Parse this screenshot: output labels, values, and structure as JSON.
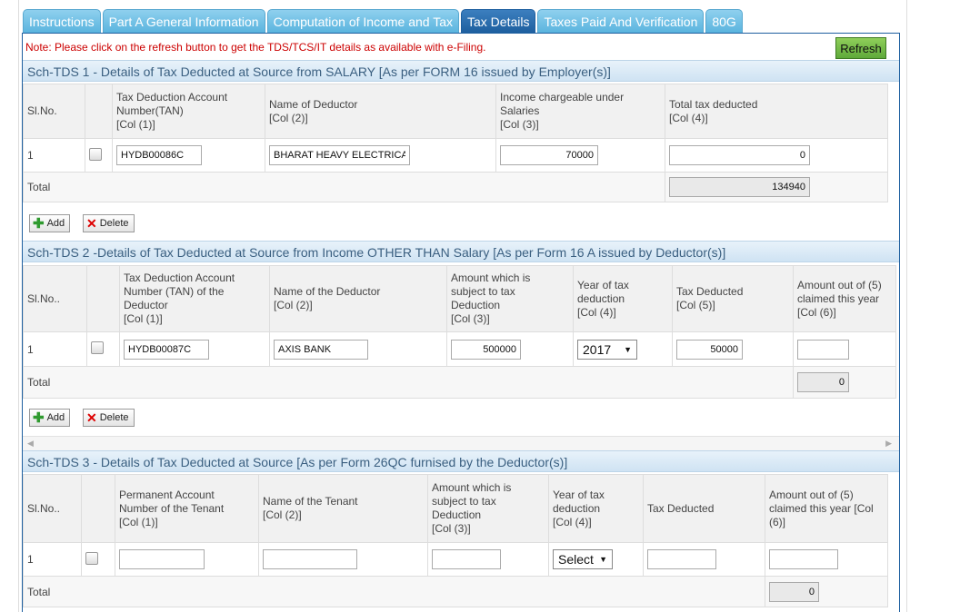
{
  "tabs": [
    "Instructions",
    "Part A General Information",
    "Computation of Income and Tax",
    "Tax Details",
    "Taxes Paid And Verification",
    "80G"
  ],
  "active_tab": "Tax Details",
  "note": "Note: Please click on the refresh button to get the TDS/TCS/IT details as available with e-Filing.",
  "refresh_label": "Refresh",
  "add_label": "Add",
  "delete_label": "Delete",
  "tds1": {
    "title": "Sch-TDS 1 - Details of Tax Deducted at Source from SALARY [As per FORM 16 issued by Employer(s)]",
    "headers": {
      "slno": "Sl.No.",
      "tan_l1": "Tax Deduction Account",
      "tan_l2": "Number(TAN)",
      "tan_l3": "[Col (1)]",
      "name_l1": "Name of Deductor",
      "name_l2": "[Col (2)]",
      "income_l1": "Income chargeable under",
      "income_l2": "Salaries",
      "income_l3": "[Col (3)]",
      "tax_l1": "Total tax deducted",
      "tax_l2": "[Col (4)]"
    },
    "row": {
      "sl": "1",
      "tan": "HYDB00086C",
      "name": "BHARAT HEAVY ELECTRICAL",
      "income": "70000",
      "tax": "0"
    },
    "total_label": "Total",
    "total_value": "134940"
  },
  "tds2": {
    "title": "Sch-TDS 2 -Details of Tax Deducted at Source from Income OTHER THAN Salary [As per Form 16 A issued by Deductor(s)]",
    "headers": {
      "slno": "Sl.No..",
      "tan_l1": "Tax Deduction Account",
      "tan_l2": "Number (TAN) of the",
      "tan_l3": "Deductor",
      "tan_l4": "[Col (1)]",
      "name_l1": "Name of the Deductor",
      "name_l2": "[Col (2)]",
      "amt_l1": "Amount which is",
      "amt_l2": "subject to tax",
      "amt_l3": "Deduction",
      "amt_l4": "[Col (3)]",
      "year_l1": "Year of tax",
      "year_l2": "deduction",
      "year_l3": "[Col (4)]",
      "tax_l1": "Tax Deducted",
      "tax_l2": "[Col (5)]",
      "claim_l1": "Amount out of (5)",
      "claim_l2": "claimed this year",
      "claim_l3": "[Col (6)]"
    },
    "row": {
      "sl": "1",
      "tan": "HYDB00087C",
      "name": "AXIS BANK",
      "amount": "500000",
      "year": "2017",
      "tax": "50000",
      "claimed": ""
    },
    "total_label": "Total",
    "total_value": "0"
  },
  "tds3": {
    "title": "Sch-TDS 3 - Details of Tax Deducted at Source [As per Form 26QC furnised by the Deductor(s)]",
    "headers": {
      "slno": "Sl.No..",
      "pan_l1": "Permanent Account",
      "pan_l2": "Number of the Tenant",
      "pan_l3": "[Col (1)]",
      "name_l1": "Name of the Tenant",
      "name_l2": "[Col (2)]",
      "amt_l1": "Amount which is",
      "amt_l2": "subject to tax",
      "amt_l3": "Deduction",
      "amt_l4": "[Col (3)]",
      "year_l1": "Year of tax",
      "year_l2": "deduction",
      "year_l3": "[Col (4)]",
      "tax_l1": "Tax Deducted",
      "claim_l1": "Amount out of (5)",
      "claim_l2": "claimed this year [Col",
      "claim_l3": "(6)]"
    },
    "row": {
      "sl": "1",
      "pan": "",
      "name": "",
      "amount": "",
      "year": "Select",
      "tax": "",
      "claimed": ""
    },
    "total_label": "Total",
    "total_value": "0"
  },
  "icons": {
    "add": "plus-icon",
    "delete": "x-icon",
    "dropdown": "caret-down-icon",
    "scroll_left": "arrow-left-icon",
    "scroll_right": "arrow-right-icon"
  },
  "colors": {
    "note": "#cc0000",
    "active_tab": "#1e5f9f",
    "tab": "#5ab4de",
    "refresh": "#6bb544"
  }
}
